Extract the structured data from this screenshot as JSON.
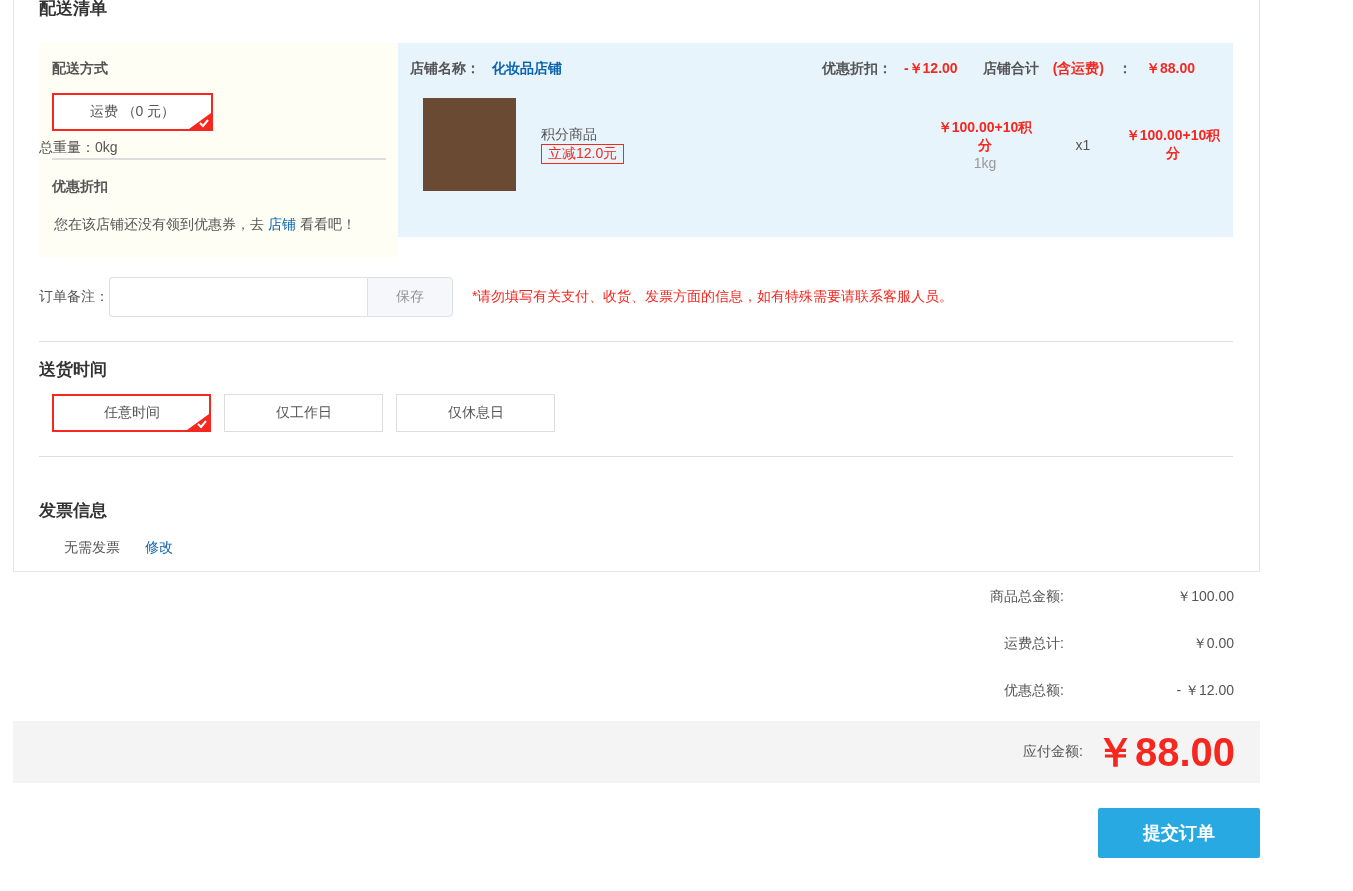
{
  "section_title": "配送清单",
  "shipping": {
    "heading": "配送方式",
    "options": [
      {
        "label": "运费 （0 元）",
        "selected": true
      }
    ],
    "weight": "总重量：0kg"
  },
  "discount": {
    "heading": "优惠折扣",
    "text_before": "您在该店铺还没有领到优惠券，去 ",
    "link": "店铺",
    "text_after": " 看看吧！"
  },
  "store": {
    "name_label": "店铺名称：",
    "name": "化妆品店铺",
    "discount_label": "优惠折扣：",
    "discount": "-￥12.00",
    "total_label": "店铺合计",
    "total_note": "(含运费)",
    "colon": "：",
    "total": "￥88.00"
  },
  "items": [
    {
      "name": "积分商品",
      "promo": "立减12.0元",
      "price": "￥100.00+10积分",
      "weight": "1kg",
      "qty": "x1",
      "subtotal": "￥100.00+10积分"
    }
  ],
  "remark": {
    "label": "订单备注：",
    "save": "保存",
    "warning": "*请勿填写有关支付、收货、发票方面的信息，如有特殊需要请联系客服人员。"
  },
  "delivery_time": {
    "heading": "送货时间",
    "options": [
      {
        "label": "任意时间",
        "selected": true
      },
      {
        "label": "仅工作日",
        "selected": false
      },
      {
        "label": "仅休息日",
        "selected": false
      }
    ]
  },
  "invoice": {
    "heading": "发票信息",
    "value": "无需发票",
    "edit": "修改"
  },
  "summary": [
    {
      "label": "商品总金额:",
      "value": "￥100.00"
    },
    {
      "label": "运费总计:",
      "value": "￥0.00"
    },
    {
      "label": "优惠总额:",
      "value": "- ￥12.00"
    }
  ],
  "payable": {
    "label": "应付金额:",
    "value": "￥88.00"
  },
  "submit": "提交订单"
}
